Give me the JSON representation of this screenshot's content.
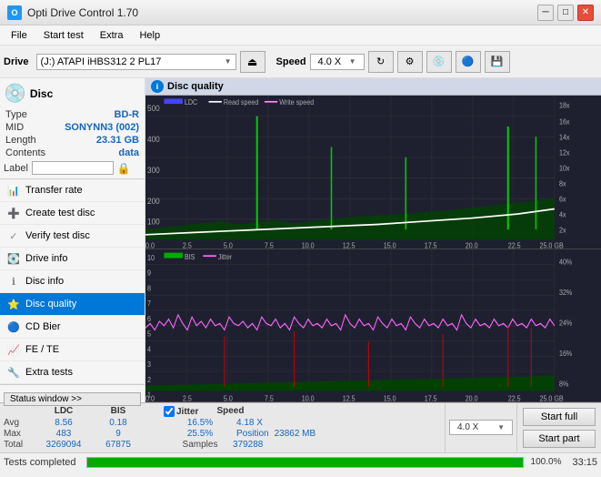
{
  "titlebar": {
    "title": "Opti Drive Control 1.70",
    "icon": "O",
    "minimize": "─",
    "maximize": "□",
    "close": "✕"
  },
  "menubar": {
    "items": [
      "File",
      "Start test",
      "Extra",
      "Help"
    ]
  },
  "toolbar": {
    "drive_label": "Drive",
    "drive_value": "(J:) ATAPI iHBS312 2 PL17",
    "eject_icon": "⏏",
    "speed_label": "Speed",
    "speed_value": "4.0 X",
    "toolbar_icons": [
      "refresh",
      "settings",
      "disc1",
      "disc2",
      "save"
    ]
  },
  "disc_panel": {
    "title": "Disc",
    "type_label": "Type",
    "type_value": "BD-R",
    "mid_label": "MID",
    "mid_value": "SONYNN3 (002)",
    "length_label": "Length",
    "length_value": "23.31 GB",
    "contents_label": "Contents",
    "contents_value": "data",
    "label_label": "Label"
  },
  "nav": {
    "items": [
      {
        "id": "transfer-rate",
        "label": "Transfer rate",
        "active": false
      },
      {
        "id": "create-test-disc",
        "label": "Create test disc",
        "active": false
      },
      {
        "id": "verify-test-disc",
        "label": "Verify test disc",
        "active": false
      },
      {
        "id": "drive-info",
        "label": "Drive info",
        "active": false
      },
      {
        "id": "disc-info",
        "label": "Disc info",
        "active": false
      },
      {
        "id": "disc-quality",
        "label": "Disc quality",
        "active": true
      },
      {
        "id": "cd-bier",
        "label": "CD Bier",
        "active": false
      },
      {
        "id": "fe-te",
        "label": "FE / TE",
        "active": false
      },
      {
        "id": "extra-tests",
        "label": "Extra tests",
        "active": false
      }
    ]
  },
  "chart_panel": {
    "title": "Disc quality",
    "legend": {
      "ldc": "LDC",
      "read_speed": "Read speed",
      "write_speed": "Write speed"
    },
    "legend2": {
      "bis": "BIS",
      "jitter": "Jitter"
    },
    "right_axis_top": [
      "18x",
      "16x",
      "14x",
      "12x",
      "10x",
      "8x",
      "6x",
      "4x",
      "2x"
    ],
    "right_axis_bottom": [
      "40%",
      "32%",
      "24%",
      "16%",
      "8%"
    ],
    "x_axis": [
      "0.0",
      "2.5",
      "5.0",
      "7.5",
      "10.0",
      "12.5",
      "15.0",
      "17.5",
      "20.0",
      "22.5",
      "25.0 GB"
    ]
  },
  "stats": {
    "headers": [
      "",
      "LDC",
      "BIS",
      "",
      "Jitter",
      "Speed"
    ],
    "avg_label": "Avg",
    "avg_ldc": "8.56",
    "avg_bis": "0.18",
    "avg_jitter": "16.5%",
    "avg_speed": "4.18 X",
    "max_label": "Max",
    "max_ldc": "483",
    "max_bis": "9",
    "max_jitter": "25.5%",
    "total_label": "Total",
    "total_ldc": "3269094",
    "total_bis": "67875",
    "position_label": "Position",
    "position_value": "23862 MB",
    "samples_label": "Samples",
    "samples_value": "379288",
    "jitter_checked": true,
    "speed_value": "4.0 X"
  },
  "buttons": {
    "start_full": "Start full",
    "start_part": "Start part"
  },
  "statusbar": {
    "text": "Tests completed",
    "progress": 100,
    "progress_text": "100.0%",
    "time": "33:15"
  },
  "status_window_btn": "Status window >>"
}
